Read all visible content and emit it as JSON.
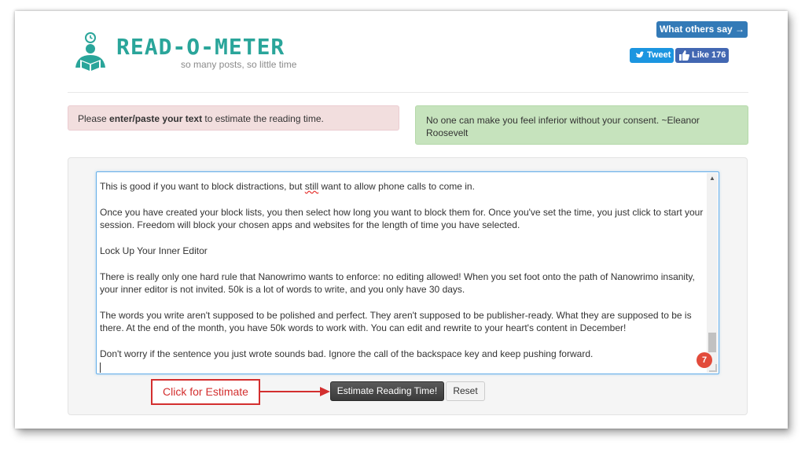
{
  "header": {
    "logo_title": "READ-O-METER",
    "logo_tagline": "so many posts, so little time",
    "others_button": "What others say →",
    "tweet_label": "Tweet",
    "like_label": "Like",
    "like_count": "176"
  },
  "alerts": {
    "instruction_prefix": "Please ",
    "instruction_bold": "enter/paste your text",
    "instruction_suffix": " to estimate the reading time.",
    "quote": "No one can make you feel inferior without your consent. ~Eleanor Roosevelt"
  },
  "editor": {
    "p1_a": "This is good if you want to block distractions, but ",
    "p1_misspelled": "still",
    "p1_b": " want to allow phone calls to come in.",
    "p2": "Once you have created your block lists, you then select how long you want to block them for. Once you've set the time, you just click to start your session. Freedom will block your chosen apps and websites for the length of time you have selected.",
    "p3": "Lock Up Your Inner Editor",
    "p4": "There is really only one hard rule that Nanowrimo wants to enforce: no editing allowed! When you set foot onto the path of Nanowrimo insanity, your inner editor is not invited. 50k is a lot of words to write, and you only have 30 days.",
    "p5": "The words you write aren't supposed to be polished and perfect. They aren't supposed to be publisher-ready. What they are supposed to be is there. At the end of the month, you have 50k words to work with. You can edit and rewrite to your heart's content in December!",
    "p6": "Don't worry if the sentence you just wrote sounds bad. Ignore the call of the backspace key and keep pushing forward.",
    "badge_count": "7",
    "scroll_position": 0.88
  },
  "actions": {
    "callout": "Click for Estimate",
    "estimate_button": "Estimate Reading Time!",
    "reset_button": "Reset"
  },
  "colors": {
    "brand_teal": "#2aa59a",
    "annotation_red": "#d32f2f",
    "twitter_blue": "#1b95e0",
    "facebook_blue": "#4267b2"
  },
  "icons": {
    "logo": "reader-with-clock-icon",
    "tweet": "twitter-bird-icon",
    "like": "thumbs-up-icon",
    "arrow": "arrow-right-icon"
  }
}
